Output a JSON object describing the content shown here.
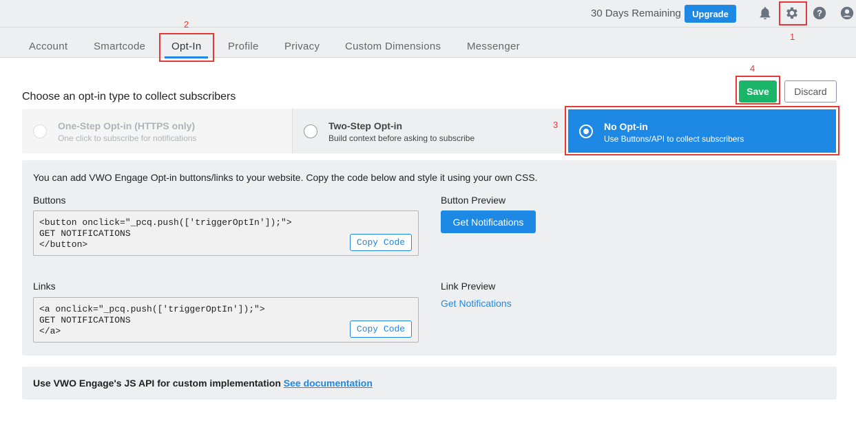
{
  "topbar": {
    "days_remaining": "30 Days Remaining",
    "upgrade": "Upgrade",
    "icons": [
      "bell-icon",
      "gear-icon",
      "help-icon",
      "user-icon"
    ]
  },
  "tabs": [
    "Account",
    "Smartcode",
    "Opt-In",
    "Profile",
    "Privacy",
    "Custom Dimensions",
    "Messenger"
  ],
  "active_tab": "Opt-In",
  "annotations": [
    "1",
    "2",
    "3",
    "4"
  ],
  "heading": "Choose an opt-in type to collect subscribers",
  "save": "Save",
  "discard": "Discard",
  "options": [
    {
      "title": "One-Step Opt-in (HTTPS only)",
      "subtitle": "One click to subscribe for notifications",
      "state": "disabled"
    },
    {
      "title": "Two-Step Opt-in",
      "subtitle": "Build context before asking to subscribe",
      "state": "unselected"
    },
    {
      "title": "No Opt-in",
      "subtitle": "Use Buttons/API to collect subscribers",
      "state": "selected"
    }
  ],
  "panel": {
    "intro": "You can add VWO Engage Opt-in buttons/links to your website. Copy the code below and style it using your own CSS.",
    "buttons_label": "Buttons",
    "buttons_code": "<button onclick=\"_pcq.push(['triggerOptIn']);\">\nGET NOTIFICATIONS\n</button>",
    "button_preview_label": "Button Preview",
    "button_preview": "Get Notifications",
    "links_label": "Links",
    "links_code": "<a onclick=\"_pcq.push(['triggerOptIn']);\">\nGET NOTIFICATIONS\n</a>",
    "link_preview_label": "Link Preview",
    "link_preview": "Get Notifications",
    "copy_code": "Copy Code"
  },
  "api": {
    "text": "Use VWO Engage's JS API for custom implementation ",
    "link": "See documentation"
  },
  "colors": {
    "primary": "#1e88e5",
    "save": "#1bb56a",
    "annotation": "#e53935"
  }
}
